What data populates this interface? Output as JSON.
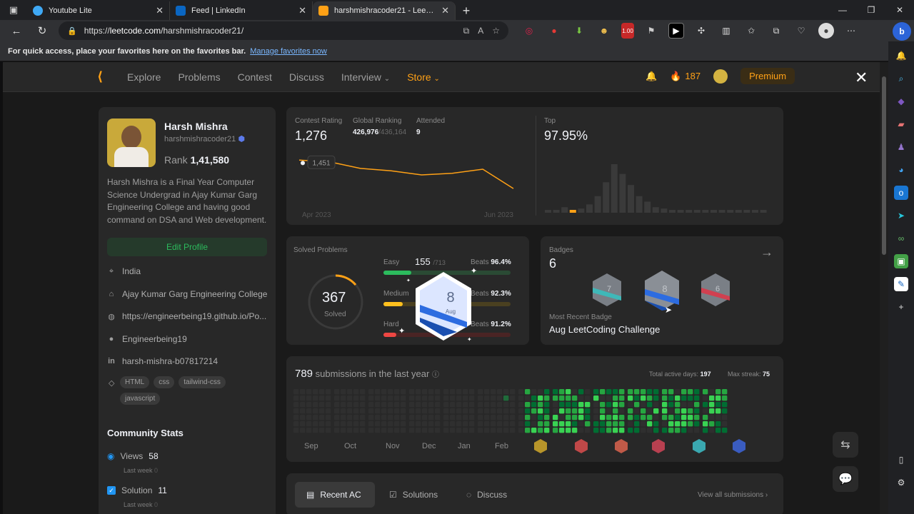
{
  "browser": {
    "tabs": [
      {
        "label": "Youtube Lite",
        "active": false,
        "color": "#3fa9f5"
      },
      {
        "label": "Feed | LinkedIn",
        "active": false,
        "color": "#0a66c2"
      },
      {
        "label": "harshmishracoder21 - LeetCode",
        "active": true,
        "color": "#ffa116"
      }
    ],
    "url_prefix": "https://",
    "url_host": "leetcode.com",
    "url_path": "/harshmishracoder21/",
    "favbar_text": "For quick access, place your favorites here on the favorites bar.",
    "favbar_link": "Manage favorites now",
    "ext_badge": "1.00"
  },
  "nav": {
    "links": [
      "Explore",
      "Problems",
      "Contest",
      "Discuss",
      "Interview",
      "Store"
    ],
    "streak": "187",
    "premium": "Premium"
  },
  "profile": {
    "name": "Harsh Mishra",
    "username": "harshmishracoder21",
    "rank_label": "Rank",
    "rank_value": "1,41,580",
    "bio": "Harsh Mishra is a Final Year Computer Science Undergrad in Ajay Kumar Garg Engineering College and having good command on DSA and Web development.",
    "edit_label": "Edit Profile",
    "location": "India",
    "college": "Ajay Kumar Garg Engineering College",
    "website": "https://engineerbeing19.github.io/Po...",
    "github": "Engineerbeing19",
    "linkedin": "harsh-mishra-b07817214",
    "tags": [
      "HTML",
      "css",
      "tailwind-css",
      "javascript"
    ]
  },
  "community": {
    "title": "Community Stats",
    "views_label": "Views",
    "views_value": "58",
    "views_sub": "Last week",
    "views_sub_value": "0",
    "solution_label": "Solution",
    "solution_value": "11",
    "solution_sub": "Last week",
    "solution_sub_value": "0"
  },
  "contest": {
    "rating_label": "Contest Rating",
    "rating_value": "1,276",
    "global_label": "Global Ranking",
    "global_value": "426,976",
    "global_total": "/436,164",
    "attended_label": "Attended",
    "attended_value": "9",
    "tooltip": "1,451",
    "x_start": "Apr 2023",
    "x_end": "Jun 2023",
    "top_label": "Top",
    "top_value": "97.95%",
    "line_color": "#ffa116"
  },
  "chart_data": [
    {
      "type": "line",
      "title": "",
      "xlabel": "",
      "ylabel": "",
      "x": [
        "Apr 2023",
        "",
        "",
        "",
        "",
        "",
        "",
        "Jun 2023"
      ],
      "values": [
        1451,
        1440,
        1400,
        1385,
        1360,
        1370,
        1395,
        1276
      ]
    },
    {
      "type": "bar",
      "title": "",
      "values": [
        2,
        2,
        4,
        2,
        3,
        6,
        12,
        22,
        35,
        28,
        20,
        12,
        8,
        4,
        3,
        2,
        2,
        2,
        1,
        1,
        1,
        1,
        1,
        1,
        1,
        1,
        1
      ],
      "highlight_index": 3
    }
  ],
  "solved": {
    "title": "Solved Problems",
    "total": "367",
    "total_label": "Solved",
    "easy_label": "Easy",
    "easy_value": "155",
    "easy_total": "/713",
    "easy_beats_label": "Beats",
    "easy_beats": "96.4%",
    "medium_label": "Medium",
    "medium_beats_label": "Beats",
    "medium_beats": "92.3%",
    "hard_label": "Hard",
    "hard_beats_label": "Beats",
    "hard_beats": "91.2%",
    "easy_fill": 0.22,
    "medium_fill": 0.15,
    "hard_fill": 0.1,
    "badge_text": "8",
    "badge_sub": "Aug"
  },
  "badges": {
    "title": "Badges",
    "count": "6",
    "recent_label": "Most Recent Badge",
    "recent_name": "Aug LeetCoding Challenge",
    "items": [
      "7",
      "8",
      "6"
    ]
  },
  "heat": {
    "count": "789",
    "label": "submissions in the last year",
    "active_label": "Total active days:",
    "active_value": "197",
    "streak_label": "Max streak:",
    "streak_value": "75",
    "months": [
      "Sep",
      "Oct",
      "Nov",
      "Dec",
      "Jan",
      "Feb",
      "",
      "",
      "",
      "",
      "",
      ""
    ]
  },
  "tabs": {
    "recent": "Recent AC",
    "solutions": "Solutions",
    "discuss": "Discuss",
    "view_all": "View all submissions"
  }
}
